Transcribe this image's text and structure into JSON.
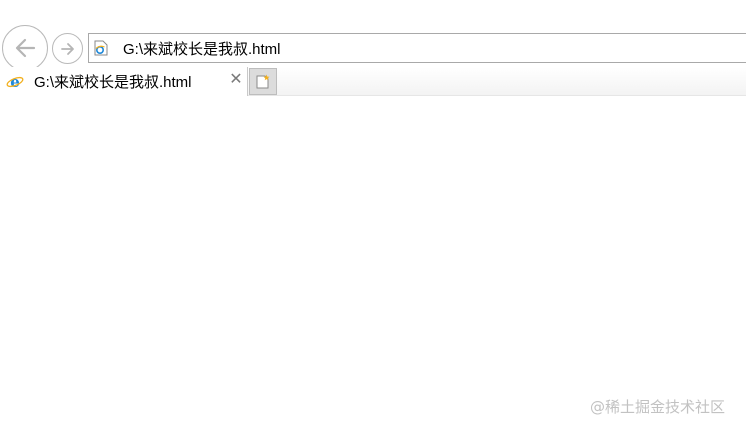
{
  "navigation": {
    "back_icon": "arrow-left-icon",
    "forward_icon": "arrow-right-icon"
  },
  "address_bar": {
    "page_icon": "ie-document-icon",
    "url": "G:\\来斌校长是我叔.html"
  },
  "tabs": [
    {
      "icon": "ie-logo-icon",
      "title": "G:\\来斌校长是我叔.html",
      "close_icon": "close-icon",
      "close_glyph": "✕"
    }
  ],
  "new_tab": {
    "icon": "new-tab-icon"
  },
  "colors": {
    "ie_blue": "#1e88d8",
    "ie_ring": "#f2b01e",
    "border_gray": "#b9b9b9"
  },
  "watermark": {
    "text": "@稀土掘金技术社区"
  }
}
